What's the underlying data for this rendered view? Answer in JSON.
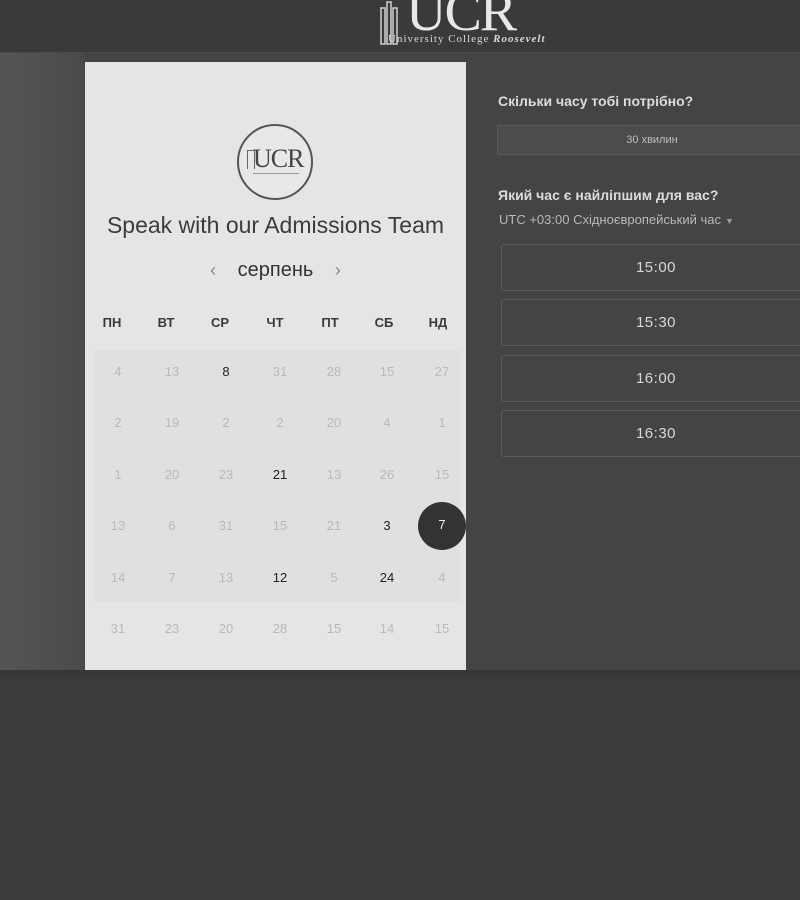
{
  "header": {
    "logo_letters": "UCR",
    "logo_subtitle_plain": "University College ",
    "logo_subtitle_italic": "Roosevelt"
  },
  "calendar": {
    "logo_letters": "UCR",
    "title": "Speak with our Admissions Team",
    "month": "серпень",
    "prev_icon": "‹",
    "next_icon": "›",
    "weekdays": [
      "ПН",
      "ВТ",
      "СР",
      "ЧТ",
      "ПТ",
      "СБ",
      "НД"
    ],
    "rows": [
      [
        "4",
        "13",
        "8",
        "31",
        "28",
        "15",
        "27"
      ],
      [
        "2",
        "19",
        "2",
        "2",
        "20",
        "4",
        "1"
      ],
      [
        "1",
        "20",
        "23",
        "21",
        "13",
        "26",
        "15"
      ],
      [
        "13",
        "6",
        "31",
        "15",
        "21",
        "3",
        "7"
      ],
      [
        "14",
        "7",
        "13",
        "12",
        "5",
        "24",
        "4"
      ],
      [
        "31",
        "23",
        "20",
        "28",
        "15",
        "14",
        "15"
      ]
    ],
    "available": [
      [
        0,
        2
      ],
      [
        2,
        3
      ],
      [
        3,
        5
      ],
      [
        4,
        3
      ],
      [
        4,
        5
      ]
    ],
    "selected": [
      3,
      6
    ]
  },
  "booking": {
    "duration_question": "Скільки часу тобі потрібно?",
    "duration_value": "30 хвилин",
    "time_question": "Який час є найліпшим для вас?",
    "timezone": "UTC +03:00 Східноєвропейський час",
    "timezone_caret": "▼",
    "slots": [
      "15:00",
      "15:30",
      "16:00",
      "16:30"
    ]
  }
}
